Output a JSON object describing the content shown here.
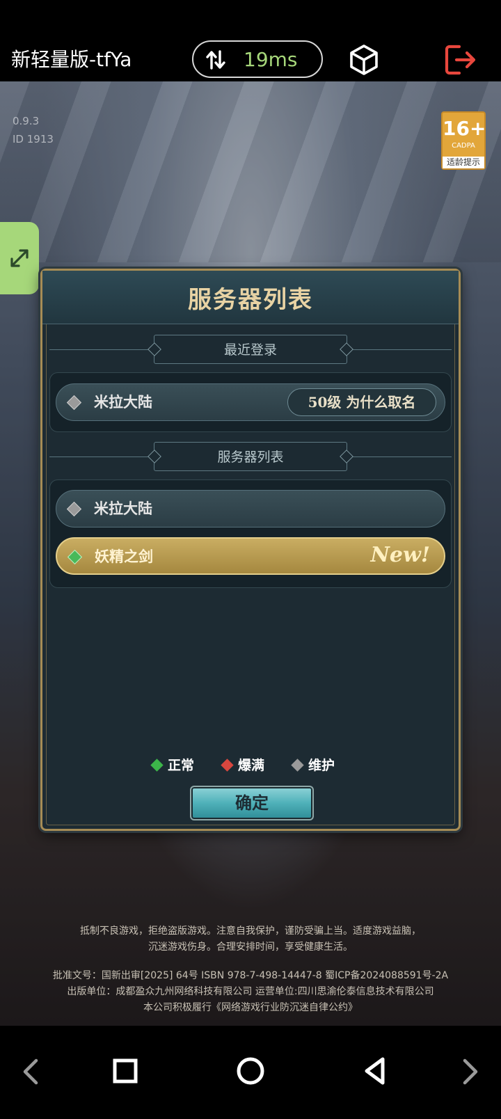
{
  "topbar": {
    "app_title": "新轻量版-tfYa",
    "ping": "19ms",
    "icons": [
      "swap-vertical-icon",
      "cube-icon",
      "exit-icon"
    ],
    "ping_color": "#a6d77a",
    "exit_color": "#e8473d"
  },
  "game": {
    "version_line1": "0.9.3",
    "version_line2": "ID 1913",
    "age_rating": {
      "age": "16+",
      "org": "CADPA",
      "tip": "适龄提示"
    },
    "dialog": {
      "title": "服务器列表",
      "recent_section": {
        "label": "最近登录",
        "rows": [
          {
            "server": "米拉大陆",
            "character": "50级 为什么取名",
            "status": "maintenance"
          }
        ]
      },
      "list_section": {
        "label": "服务器列表",
        "rows": [
          {
            "server": "米拉大陆",
            "status": "maintenance",
            "tag": ""
          },
          {
            "server": "妖精之剑",
            "status": "normal",
            "tag": "New!",
            "selected": true
          }
        ]
      },
      "legend": [
        {
          "label": "正常",
          "color": "#3cb54a"
        },
        {
          "label": "爆满",
          "color": "#d9473f"
        },
        {
          "label": "维护",
          "color": "#9a9a9a"
        }
      ],
      "confirm_label": "确定"
    },
    "notice": {
      "line1": "抵制不良游戏，拒绝盗版游戏。注意自我保护，谨防受骗上当。适度游戏益脑，",
      "line2": "沉迷游戏伤身。合理安排时间，享受健康生活。",
      "line3": "批准文号：国新出审[2025] 64号 ISBN 978-7-498-14447-8 蜀ICP备2024088591号-2A",
      "line4": "出版单位：成都盈众九州网络科技有限公司 运营单位:四川思渝伦泰信息技术有限公司",
      "line5": "本公司积极履行《网络游戏行业防沉迷自律公约》"
    }
  },
  "navbar": {
    "icons": [
      "back-chevron-icon",
      "recents-square-icon",
      "home-circle-icon",
      "back-triangle-icon",
      "forward-chevron-icon"
    ]
  }
}
